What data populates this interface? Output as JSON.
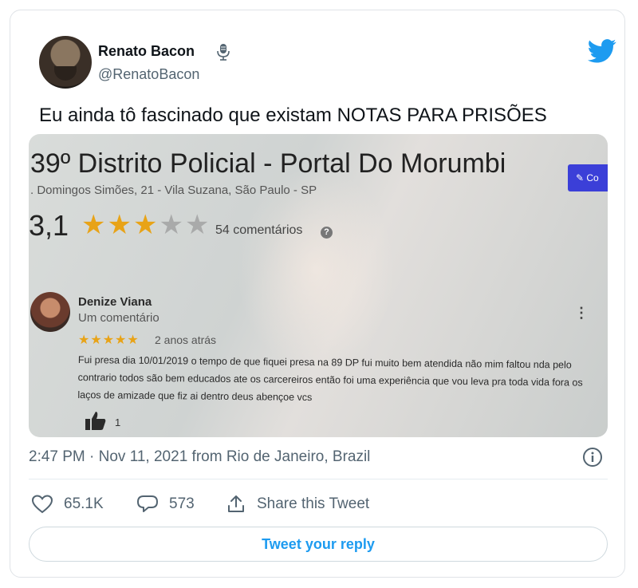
{
  "author": {
    "name": "Renato Bacon",
    "handle": "@RenatoBacon"
  },
  "tweet": {
    "text": "Eu ainda tô fascinado que existam NOTAS PARA PRISÕES",
    "timestamp": "2:47 PM · Nov 11, 2021 from Rio de Janeiro, Brazil"
  },
  "media": {
    "title": "39º Distrito Policial - Portal Do Morumbi",
    "address": ". Domingos Simões, 21 - Vila Suzana, São Paulo - SP",
    "rating": "3,1",
    "rating_stars": 3,
    "comments": "54 comentários",
    "write_button": "Co",
    "review": {
      "author": "Denize Viana",
      "meta": "Um comentário",
      "stars": 5,
      "age": "2 anos atrás",
      "body": "Fui presa dia 10/01/2019 o tempo de que fiquei presa na 89 DP fui muito bem atendida não mim faltou nda pelo contrario todos são bem educados ate os carcereiros então foi uma experiência que vou leva pra toda vida fora os laços de amizade que fiz ai dentro deus abençoe vcs",
      "likes": "1"
    }
  },
  "actions": {
    "likes": "65.1K",
    "replies": "573",
    "share_label": "Share this Tweet"
  },
  "reply_button": "Tweet your reply",
  "colors": {
    "twitter_blue": "#1d9bf0",
    "secondary_text": "#536471",
    "star_gold": "#e8a317",
    "write_button": "#3b3fd8"
  }
}
